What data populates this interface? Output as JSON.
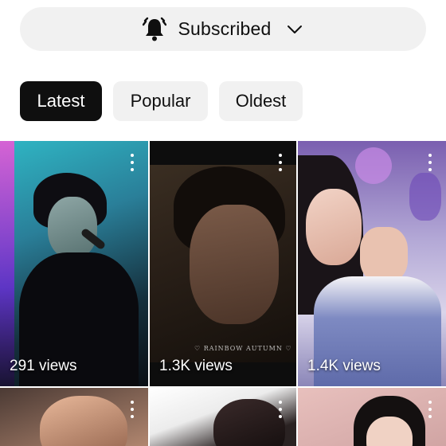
{
  "subscribe": {
    "label": "Subscribed",
    "bell_icon": "bell-ringing-icon",
    "chevron_icon": "chevron-down-icon"
  },
  "filters": [
    {
      "label": "Latest",
      "active": true
    },
    {
      "label": "Popular",
      "active": false
    },
    {
      "label": "Oldest",
      "active": false
    }
  ],
  "shorts": [
    {
      "views": "291 views",
      "menu_icon": "more-vert-icon"
    },
    {
      "views": "1.3K views",
      "caption": "♡ RAINBOW AUTUMN ♡",
      "menu_icon": "more-vert-icon"
    },
    {
      "views": "1.4K views",
      "menu_icon": "more-vert-icon"
    },
    {
      "menu_icon": "more-vert-icon"
    },
    {
      "menu_icon": "more-vert-icon"
    },
    {
      "menu_icon": "more-vert-icon"
    }
  ],
  "colors": {
    "chip_active_bg": "#0f0f0f",
    "chip_bg": "#f1f1f1",
    "text": "#0f0f0f"
  }
}
